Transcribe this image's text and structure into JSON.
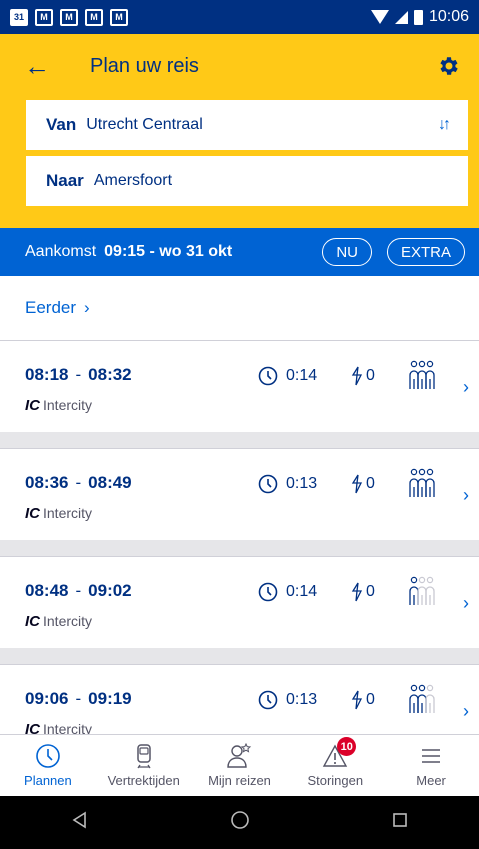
{
  "status_bar": {
    "time": "10:06",
    "calendar_day": "31"
  },
  "header": {
    "title": "Plan uw reis"
  },
  "from": {
    "label": "Van",
    "value": "Utrecht Centraal"
  },
  "to": {
    "label": "Naar",
    "value": "Amersfoort"
  },
  "timebar": {
    "label": "Aankomst",
    "value": "09:15 - wo 31 okt",
    "now_button": "NU",
    "extra_button": "EXTRA"
  },
  "earlier": {
    "label": "Eerder"
  },
  "trips": [
    {
      "depart": "08:18",
      "arrive": "08:32",
      "type_code": "IC",
      "type_name": "Intercity",
      "duration": "0:14",
      "transfers": "0",
      "crowd_level": 3
    },
    {
      "depart": "08:36",
      "arrive": "08:49",
      "type_code": "IC",
      "type_name": "Intercity",
      "duration": "0:13",
      "transfers": "0",
      "crowd_level": 3
    },
    {
      "depart": "08:48",
      "arrive": "09:02",
      "type_code": "IC",
      "type_name": "Intercity",
      "duration": "0:14",
      "transfers": "0",
      "crowd_level": 1
    },
    {
      "depart": "09:06",
      "arrive": "09:19",
      "type_code": "IC",
      "type_name": "Intercity",
      "duration": "0:13",
      "transfers": "0",
      "crowd_level": 2
    }
  ],
  "bottom_nav": [
    {
      "label": "Plannen",
      "icon": "clock-icon",
      "active": true
    },
    {
      "label": "Vertrektijden",
      "icon": "train-icon"
    },
    {
      "label": "Mijn reizen",
      "icon": "person-star-icon"
    },
    {
      "label": "Storingen",
      "icon": "warning-icon",
      "badge": "10"
    },
    {
      "label": "Meer",
      "icon": "menu-icon"
    }
  ],
  "colors": {
    "header": "#ffc917",
    "primary": "#0063d3",
    "dark_blue": "#003082",
    "badge": "#db0029"
  }
}
